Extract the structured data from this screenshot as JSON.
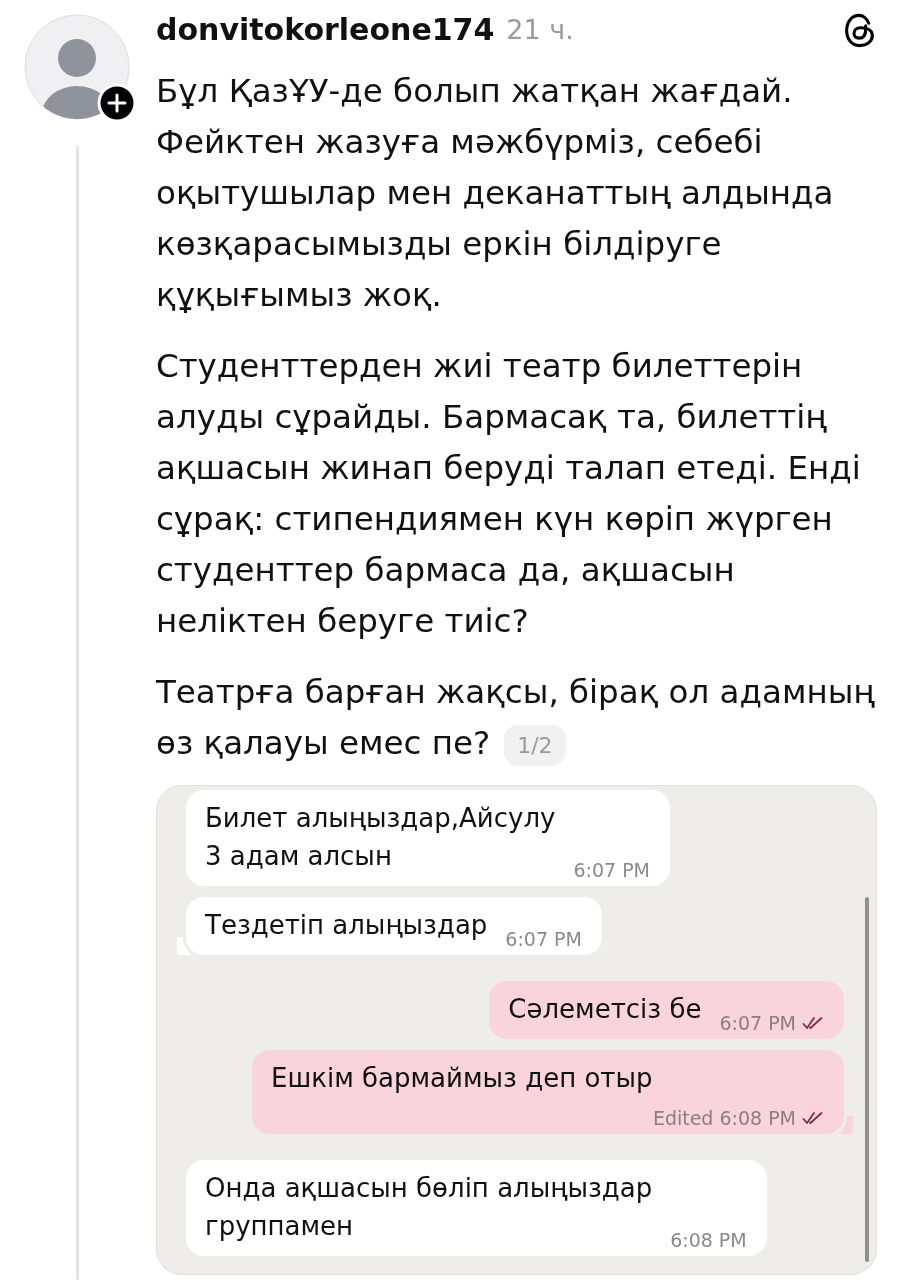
{
  "post": {
    "author": "donvitokorleone174",
    "time": "21 ч.",
    "paragraphs": [
      "Бұл ҚазҰУ-де болып жатқан жағдай.\nФейктен жазуға мәжбүрміз, себебі\nоқытушылар мен деканаттың алдында\nкөзқарасымызды еркін білдіруге\nқұқығымыз жоқ.",
      "Студенттерден жиі театр билеттерін\nалуды сұрайды. Бармасақ та, билеттің\nақшасын жинап беруді талап етеді. Енді\nсұрақ: стипендиямен күн көріп жүрген\nстуденттер бармаса да, ақшасын\nнеліктен беруге тиіс?",
      "Театрға барған жақсы, бірақ ол адамның\nөз қалауы емес пе?"
    ],
    "page_counter": "1/2"
  },
  "chat_screenshot": {
    "messages": [
      {
        "kind": "incoming",
        "text": "Билет алыңыздар,Айсулу\n3 адам алсын",
        "time": "6:07 PM",
        "tail": false
      },
      {
        "kind": "incoming",
        "text": "Тездетіп алыңыздар",
        "time": "6:07 PM",
        "tail": true
      },
      {
        "kind": "outgoing",
        "text": "Сәлеметсіз бе",
        "time": "6:07 PM",
        "read": true,
        "tail": false
      },
      {
        "kind": "outgoing",
        "text": "Ешкім бармаймыз деп отыр",
        "edited": "Edited",
        "time": "6:08 PM",
        "read": true,
        "tail": true
      },
      {
        "kind": "incoming",
        "text": "Онда ақшасын бөліп алыңыздар\nгруппамен",
        "time": "6:08 PM",
        "tail": false
      }
    ]
  }
}
